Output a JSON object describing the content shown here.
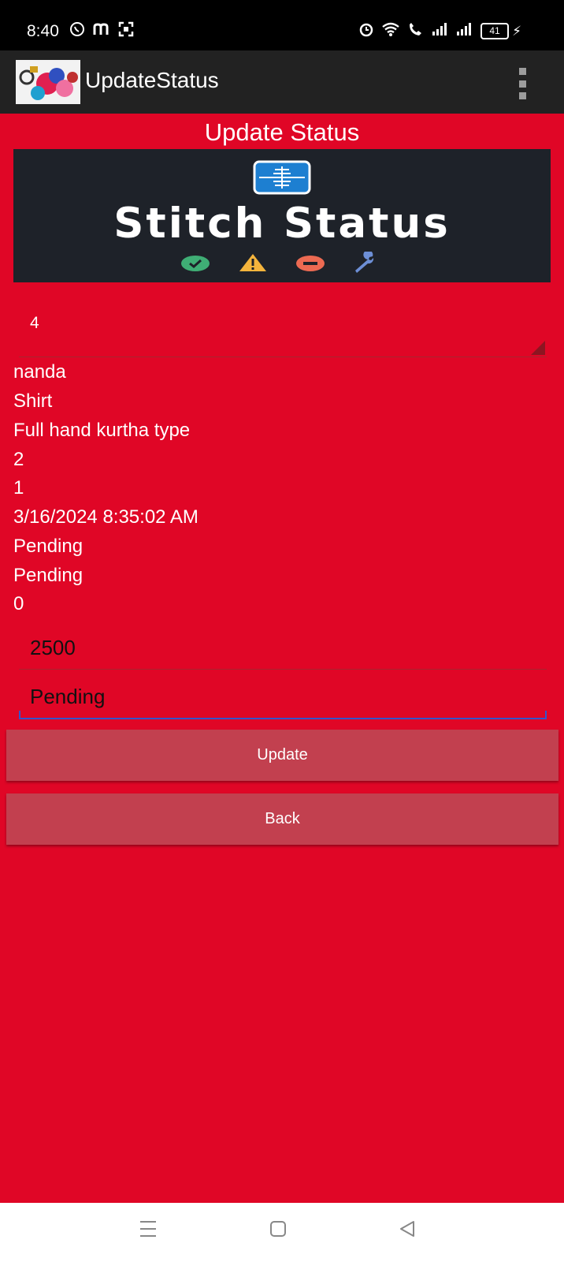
{
  "status_bar": {
    "time": "8:40",
    "battery": "41"
  },
  "app_bar": {
    "title": "UpdateStatus"
  },
  "page_title": "Update Status",
  "banner": {
    "text": "Stitch Status"
  },
  "spinner": {
    "selected": "4"
  },
  "details": [
    "nanda",
    "Shirt",
    "Full hand kurtha type",
    "2",
    "1",
    "3/16/2024 8:35:02 AM",
    "Pending",
    "Pending",
    "0"
  ],
  "fields": {
    "amount": "2500",
    "status": "Pending"
  },
  "buttons": {
    "update": "Update",
    "back": "Back"
  },
  "colors": {
    "background": "#e00626",
    "app_bar": "#222222",
    "button": "#c2404f",
    "banner": "#1e2229",
    "focus_underline": "#3355cc"
  }
}
